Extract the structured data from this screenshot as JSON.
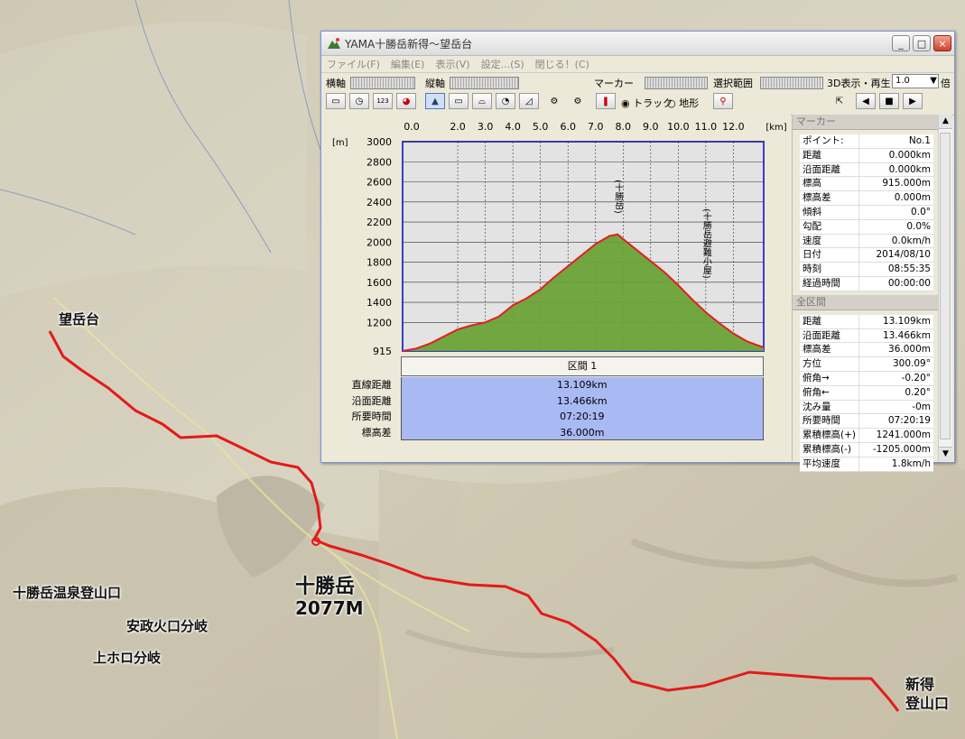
{
  "window": {
    "title": "YAMA十勝岳新得～望岳台",
    "min_label": "_",
    "max_label": "□",
    "close_label": "×"
  },
  "menu": [
    "ファイル(F)",
    "編集(E)",
    "表示(V)",
    "設定...(S)",
    "閉じる！(C)"
  ],
  "toolbar": {
    "h_axis": "横軸",
    "v_axis": "縦軸",
    "marker": "マーカー",
    "range": "選択範囲",
    "view3d": "3D表示・再生",
    "speed_value": "1.0",
    "speed_unit": "倍",
    "track_radio": "トラック",
    "terrain_radio": "地形",
    "icon_123": "123"
  },
  "chart_data": {
    "type": "area",
    "x_unit": "[km]",
    "y_unit": "[m]",
    "x_ticks": [
      "0.0",
      "2.0",
      "3.0",
      "4.0",
      "5.0",
      "6.0",
      "7.0",
      "8.0",
      "9.0",
      "10.0",
      "11.0",
      "12.0"
    ],
    "y_ticks": [
      "3000",
      "2800",
      "2600",
      "2400",
      "2200",
      "2000",
      "1800",
      "1600",
      "1400",
      "1200",
      "915"
    ],
    "xlim": [
      0,
      13.1
    ],
    "ylim": [
      915,
      3000
    ],
    "series": [
      {
        "x": [
          0,
          0.5,
          1.0,
          1.5,
          2.0,
          2.5,
          3.0,
          3.5,
          4.0,
          4.5,
          5.0,
          5.5,
          6.0,
          6.5,
          7.0,
          7.5,
          7.8,
          8.0,
          8.5,
          9.0,
          9.5,
          10.0,
          10.5,
          11.0,
          11.5,
          12.0,
          12.5,
          13.1
        ],
        "y": [
          915,
          940,
          990,
          1060,
          1130,
          1170,
          1200,
          1260,
          1370,
          1440,
          1530,
          1650,
          1760,
          1870,
          1980,
          2060,
          2077,
          2030,
          1920,
          1810,
          1700,
          1570,
          1430,
          1300,
          1190,
          1090,
          1010,
          950
        ]
      }
    ],
    "annotations": [
      "十勝岳",
      "十勝岳避難小屋"
    ],
    "fill_color": "#6aa238",
    "line_color": "#e02020",
    "grid": true
  },
  "stats": {
    "section_label": "区間 1",
    "rows": [
      {
        "label": "直線距離",
        "value": "13.109km"
      },
      {
        "label": "沿面距離",
        "value": "13.466km"
      },
      {
        "label": "所要時間",
        "value": "07:20:19"
      },
      {
        "label": "標高差",
        "value": "36.000m"
      }
    ]
  },
  "marker_panel": {
    "header": "マーカー",
    "rows": [
      {
        "k": "ポイント:",
        "v": "No.1"
      },
      {
        "k": "距離",
        "v": "0.000km"
      },
      {
        "k": "沿面距離",
        "v": "0.000km"
      },
      {
        "k": "標高",
        "v": "915.000m"
      },
      {
        "k": "標高差",
        "v": "0.000m"
      },
      {
        "k": "傾斜",
        "v": "0.0°"
      },
      {
        "k": "勾配",
        "v": "0.0%"
      },
      {
        "k": "速度",
        "v": "0.0km/h"
      },
      {
        "k": "日付",
        "v": "2014/08/10"
      },
      {
        "k": "時刻",
        "v": "08:55:35"
      },
      {
        "k": "経過時間",
        "v": "00:00:00"
      }
    ]
  },
  "all_panel": {
    "header": "全区間",
    "rows": [
      {
        "k": "距離",
        "v": "13.109km"
      },
      {
        "k": "沿面距離",
        "v": "13.466km"
      },
      {
        "k": "標高差",
        "v": "36.000m"
      },
      {
        "k": "方位",
        "v": "300.09°"
      },
      {
        "k": "俯角→",
        "v": "-0.20°"
      },
      {
        "k": "俯角←",
        "v": "0.20°"
      },
      {
        "k": "沈み量",
        "v": "-0m"
      },
      {
        "k": "所要時間",
        "v": "07:20:19"
      },
      {
        "k": "累積標高(+)",
        "v": "1241.000m"
      },
      {
        "k": "累積標高(-)",
        "v": "-1205.000m"
      },
      {
        "k": "平均速度",
        "v": "1.8km/h"
      }
    ]
  },
  "map": {
    "labels": {
      "bogakudai": "望岳台",
      "tokachidake": "十勝岳",
      "tokachidake_elev": "2077M",
      "onsen": "十勝岳温泉登山口",
      "anseikako": "安政火口分岐",
      "kamihoro": "上ホロ分岐",
      "shintoku1": "新得",
      "shintoku2": "登山口"
    },
    "track_color": "#e41a1a"
  }
}
